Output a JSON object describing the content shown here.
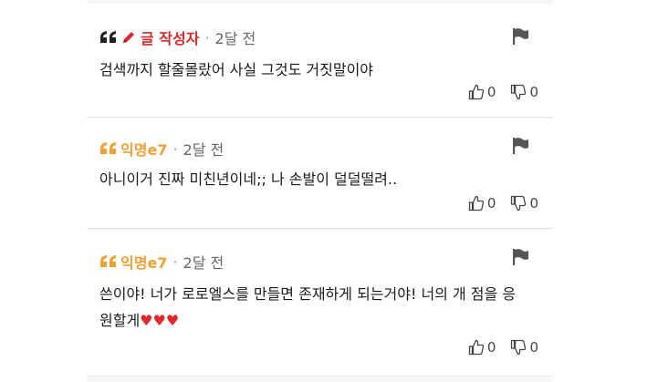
{
  "comments": [
    {
      "author": "글 작성자",
      "time": "2달 전",
      "text": "검색까지 할줄몰랐어 사실 그것도 거짓말이야",
      "hearts": "",
      "likes": "0",
      "dislikes": "0"
    },
    {
      "author": "익명e7",
      "time": "2달 전",
      "text": "아니이거 진짜 미친년이네;; 나 손발이 덜덜떨려..",
      "hearts": "",
      "likes": "0",
      "dislikes": "0"
    },
    {
      "author": "익명e7",
      "time": "2달 전",
      "text": "쓴이야! 너가 로로엘스를 만들면 존재하게 되는거야! 너의 개 점을 응원할게",
      "hearts": "♥♥♥",
      "likes": "0",
      "dislikes": "0"
    }
  ],
  "meta_separator": "·",
  "colors": {
    "author_op": "#d62b2b",
    "author_anon": "#f0a035",
    "heart": "#e0282e"
  },
  "icons": [
    "quote-icon",
    "pencil-icon",
    "flag-icon",
    "thumbs-up-icon",
    "thumbs-down-icon"
  ]
}
